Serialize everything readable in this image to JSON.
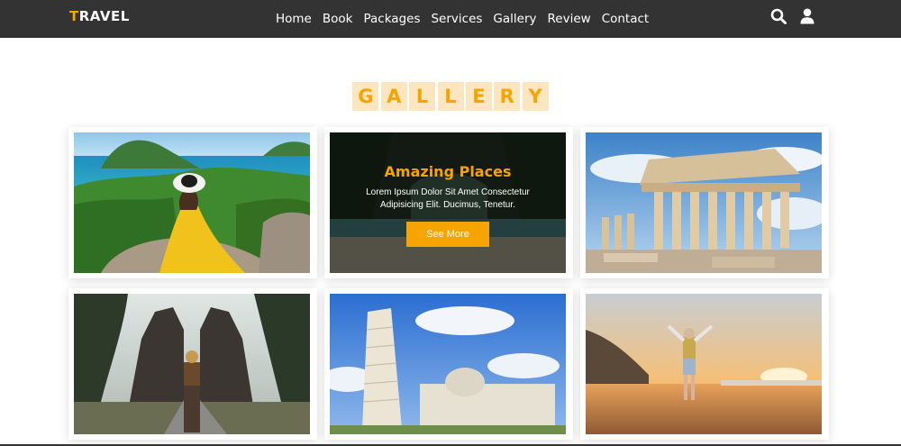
{
  "logo": {
    "first": "T",
    "rest": "RAVEL"
  },
  "nav": [
    "Home",
    "Book",
    "Packages",
    "Services",
    "Gallery",
    "Review",
    "Contact"
  ],
  "icons": [
    "search-icon",
    "user-icon"
  ],
  "heading": [
    "G",
    "A",
    "L",
    "L",
    "E",
    "R",
    "Y"
  ],
  "overlay": {
    "title": "Amazing Places",
    "description": "Lorem Ipsum Dolor Sit Amet Consectetur Adipisicing Elit. Ducimus, Tenetur.",
    "button": "See More"
  },
  "colors": {
    "accent": "#f6a500",
    "navbar": "#333333",
    "heading_bg": "#fbe6c0"
  }
}
